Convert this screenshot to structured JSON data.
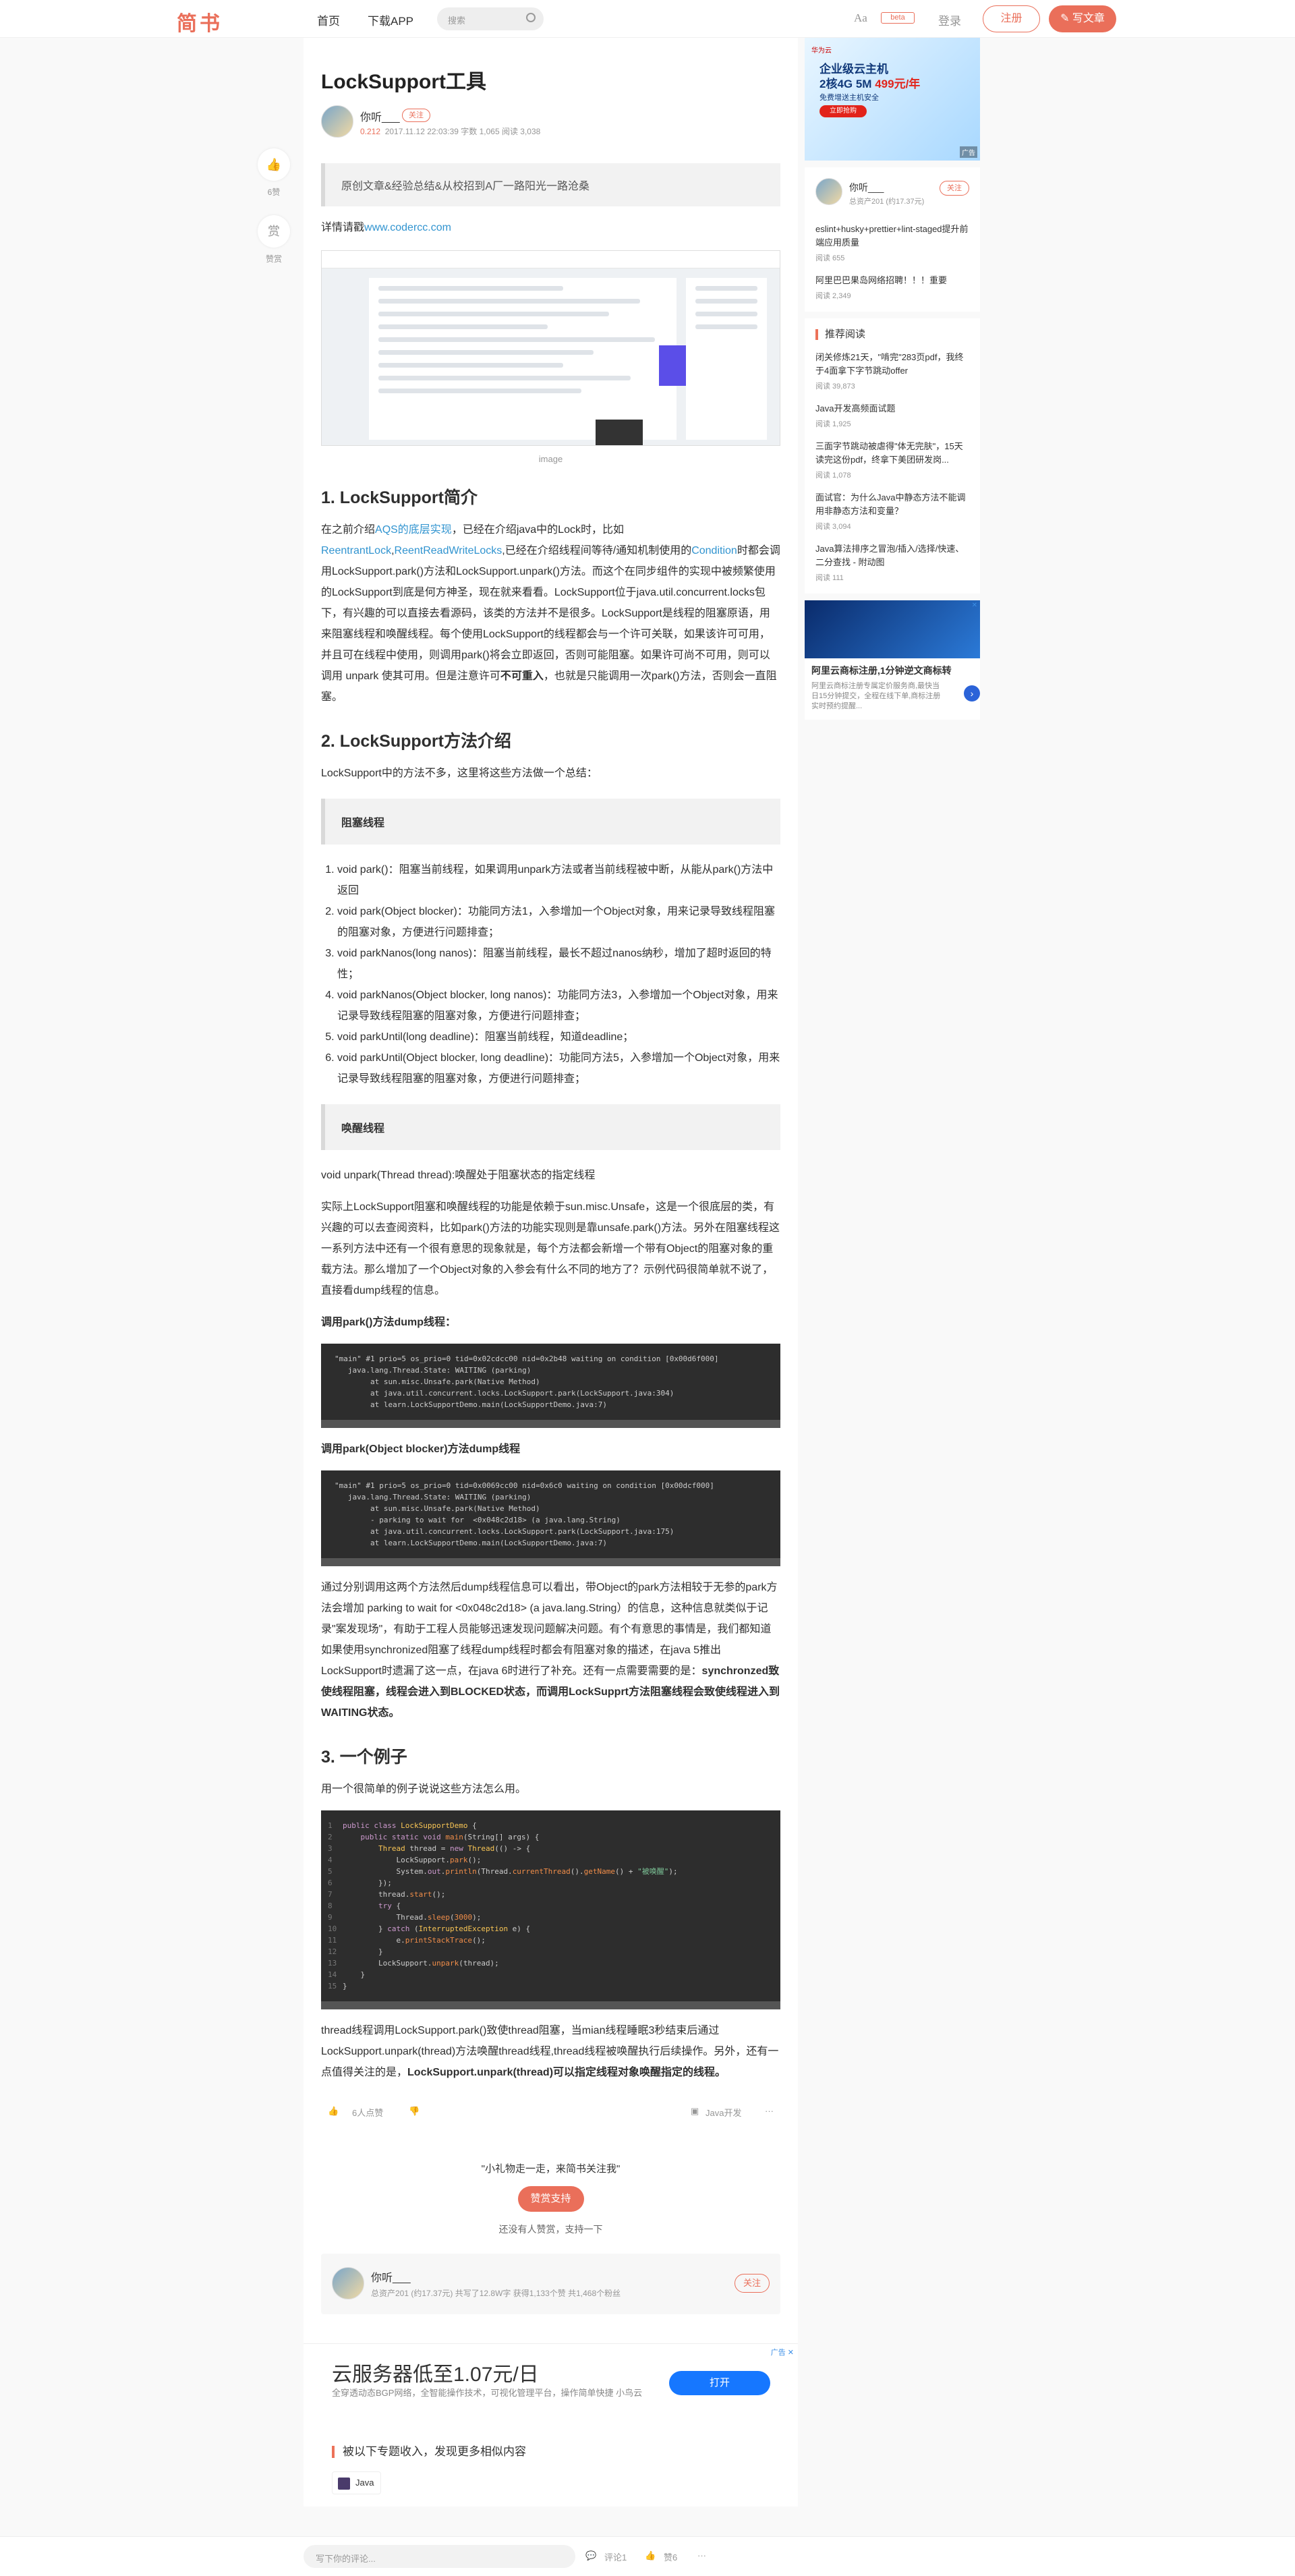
{
  "nav": {
    "logo": "简书",
    "home": "首页",
    "download": "下载APP",
    "search_placeholder": "搜索",
    "aa": "Aa",
    "beta": "beta",
    "login": "登录",
    "register": "注册",
    "write": "写文章"
  },
  "leftbar": {
    "like_count": "6赞",
    "reward": "赏",
    "reward_label": "赞赏"
  },
  "article": {
    "title": "LockSupport工具",
    "author": "你听___",
    "follow": "关注",
    "diamond": "0.212",
    "meta": "2017.11.12 22:03:39 字数 1,065 阅读 3,038",
    "quote": "原创文章&经验总结&从校招到A厂一路阳光一路沧桑",
    "details_prefix": "详情请戳",
    "details_link": "www.codercc.com",
    "image_caption": "image",
    "h1": "1. LockSupport简介",
    "p1_a": "在之前介绍",
    "p1_link1": "AQS的底层实现",
    "p1_b": "，已经在介绍java中的Lock时，比如",
    "p1_link2": "ReentrantLock",
    "p1_c": ",",
    "p1_link3": "ReentReadWriteLocks",
    "p1_d": ",已经在介绍线程间等待/通知机制使用的",
    "p1_link4": "Condition",
    "p1_e": "时都会调用LockSupport.park()方法和LockSupport.unpark()方法。而这个在同步组件的实现中被频繁使用的LockSupport到底是何方神圣，现在就来看看。LockSupport位于java.util.concurrent.locks包下，有兴趣的可以直接去看源码，该类的方法并不是很多。LockSupport是线程的阻塞原语，用来阻塞线程和唤醒线程。每个使用LockSupport的线程都会与一个许可关联，如果该许可可用，并且可在线程中使用，则调用park()将会立即返回，否则可能阻塞。如果许可尚不可用，则可以调用 unpark 使其可用。但是注意许可",
    "p1_bold": "不可重入",
    "p1_f": "，也就是只能调用一次park()方法，否则会一直阻塞。",
    "h2": "2. LockSupport方法介绍",
    "p2": "LockSupport中的方法不多，这里将这些方法做一个总结：",
    "box1": "阻塞线程",
    "list": [
      "void park()：阻塞当前线程，如果调用unpark方法或者当前线程被中断，从能从park()方法中返回",
      "void park(Object blocker)：功能同方法1，入参增加一个Object对象，用来记录导致线程阻塞的阻塞对象，方便进行问题排查；",
      "void parkNanos(long nanos)：阻塞当前线程，最长不超过nanos纳秒，增加了超时返回的特性；",
      "void parkNanos(Object blocker, long nanos)：功能同方法3，入参增加一个Object对象，用来记录导致线程阻塞的阻塞对象，方便进行问题排查；",
      "void parkUntil(long deadline)：阻塞当前线程，知道deadline；",
      "void parkUntil(Object blocker, long deadline)：功能同方法5，入参增加一个Object对象，用来记录导致线程阻塞的阻塞对象，方便进行问题排查；"
    ],
    "box2": "唤醒线程",
    "p3": "void unpark(Thread thread):唤醒处于阻塞状态的指定线程",
    "p4": "实际上LockSupport阻塞和唤醒线程的功能是依赖于sun.misc.Unsafe，这是一个很底层的类，有兴趣的可以去查阅资料，比如park()方法的功能实现则是靠unsafe.park()方法。另外在阻塞线程这一系列方法中还有一个很有意思的现象就是，每个方法都会新增一个带有Object的阻塞对象的重载方法。那么增加了一个Object对象的入参会有什么不同的地方了？示例代码很简单就不说了，直接看dump线程的信息。",
    "label1": "调用park()方法dump线程：",
    "code1": [
      "\"main\" #1 prio=5 os_prio=0 tid=0x02cdcc00 nid=0x2b48 waiting on condition [0x00d6f000]",
      "   java.lang.Thread.State: WAITING (parking)",
      "        at sun.misc.Unsafe.park(Native Method)",
      "        at java.util.concurrent.locks.LockSupport.park(LockSupport.java:304)",
      "        at learn.LockSupportDemo.main(LockSupportDemo.java:7)"
    ],
    "label2": "调用park(Object blocker)方法dump线程",
    "code2": [
      "\"main\" #1 prio=5 os_prio=0 tid=0x0069cc00 nid=0x6c0 waiting on condition [0x00dcf000]",
      "   java.lang.Thread.State: WAITING (parking)",
      "        at sun.misc.Unsafe.park(Native Method)",
      "        - parking to wait for  <0x048c2d18> (a java.lang.String)",
      "        at java.util.concurrent.locks.LockSupport.park(LockSupport.java:175)",
      "        at learn.LockSupportDemo.main(LockSupportDemo.java:7)"
    ],
    "p5_a": "通过分别调用这两个方法然后dump线程信息可以看出，带Object的park方法相较于无参的park方法会增加 parking to wait for <0x048c2d18> (a java.lang.String）的信息，这种信息就类似于记录\"案发现场\"，有助于工程人员能够迅速发现问题解决问题。有个有意思的事情是，我们都知道如果使用synchronized阻塞了线程dump线程时都会有阻塞对象的描述，在java 5推出LockSupport时遗漏了这一点，在java 6时进行了补充。还有一点需要需要的是：",
    "p5_bold": "synchronzed致使线程阻塞，线程会进入到BLOCKED状态，而调用LockSupprt方法阻塞线程会致使线程进入到WAITING状态。",
    "h3": "3. 一个例子",
    "p6": "用一个很简单的例子说说这些方法怎么用。",
    "p7_a": "thread线程调用LockSupport.park()致使thread阻塞，当mian线程睡眠3秒结束后通过LockSupport.unpark(thread)方法唤醒thread线程,thread线程被唤醒执行后续操作。另外，还有一点值得关注的是，",
    "p7_bold": "LockSupport.unpark(thread)可以指定线程对象唤醒指定的线程。",
    "likes": "6人点赞",
    "collection": "Java开发",
    "reward_quote": "\"小礼物走一走，来简书关注我\"",
    "reward_btn": "赞赏支持",
    "reward_none": "还没有人赞赏，支持一下",
    "card_meta": "总资产201 (约17.37元)   共写了12.8W字   获得1,133个赞   共1,468个粉丝"
  },
  "ad_bottom": {
    "title": "云服务器低至1.07元/日",
    "sub": "全穿透动态BGP网络，全智能操作技术，可视化管理平台，操作简单快捷 小鸟云",
    "btn": "打开",
    "tag": "广告"
  },
  "topic": {
    "header": "被以下专题收入，发现更多相似内容",
    "tag": "Java"
  },
  "right": {
    "banner_brand": "华为云",
    "banner_t1": "企业级云主机",
    "banner_t2a": "2核4G 5M ",
    "banner_t2b": "499元/年",
    "banner_t3": "免费增送主机安全",
    "banner_t4": "立即抢购",
    "banner_ad": "广告",
    "author": "你听___",
    "author_meta": "总资产201 (约17.37元)",
    "follow": "关注",
    "a1": "eslint+husky+prettier+lint-staged提升前端应用质量",
    "a1_read": "阅读 655",
    "a2": "阿里巴巴果岛网络招聘！！！重要",
    "a2_read": "阅读 2,349",
    "rec_header": "推荐阅读",
    "recs": [
      {
        "t": "闭关修炼21天，\"啃完\"283页pdf，我终于4面拿下字节跳动offer",
        "r": "阅读 39,873"
      },
      {
        "t": "Java开发高频面试题",
        "r": "阅读 1,925"
      },
      {
        "t": "三面字节跳动被虐得\"体无完肤\"，15天读完这份pdf，终拿下美团研发岗...",
        "r": "阅读 1,078"
      },
      {
        "t": "面试官：为什么Java中静态方法不能调用非静态方法和变量？",
        "r": "阅读 3,094"
      },
      {
        "t": "Java算法排序之冒泡/插入/选择/快速、二分查找 - 附动图",
        "r": "阅读 111"
      }
    ],
    "ad2_title": "阿里云商标注册,1分钟逆文商标转",
    "ad2_sub": "阿里云商标注册专属定价服务商,最快当日15分钟提交，全程在线下单,商标注册实时预约提醒..."
  },
  "footer": {
    "placeholder": "写下你的评论...",
    "comment": "评论1",
    "like": "赞6",
    "more": "···"
  }
}
